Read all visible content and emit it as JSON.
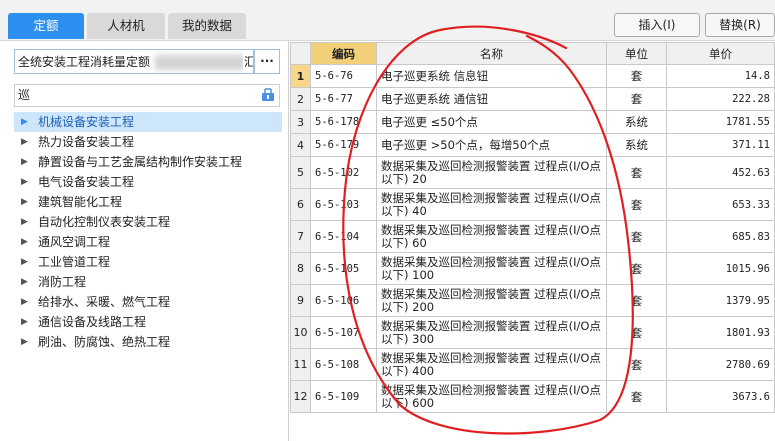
{
  "tabs": [
    {
      "label": "定额",
      "active": true
    },
    {
      "label": "人材机",
      "active": false
    },
    {
      "label": "我的数据",
      "active": false
    }
  ],
  "toolbar": {
    "insert_label": "插入(I)",
    "replace_label": "替换(R)"
  },
  "left_panel": {
    "library_value": "全统安装工程消耗量定额",
    "library_tail": "汇总表",
    "more_label": "···",
    "search_value": "巡",
    "search_icon": "filter-icon",
    "tree": [
      {
        "label": "机械设备安装工程",
        "selected": true
      },
      {
        "label": "热力设备安装工程",
        "selected": false
      },
      {
        "label": "静置设备与工艺金属结构制作安装工程",
        "selected": false
      },
      {
        "label": "电气设备安装工程",
        "selected": false
      },
      {
        "label": "建筑智能化工程",
        "selected": false
      },
      {
        "label": "自动化控制仪表安装工程",
        "selected": false
      },
      {
        "label": "通风空调工程",
        "selected": false
      },
      {
        "label": "工业管道工程",
        "selected": false
      },
      {
        "label": "消防工程",
        "selected": false
      },
      {
        "label": "给排水、采暖、燃气工程",
        "selected": false
      },
      {
        "label": "通信设备及线路工程",
        "selected": false
      },
      {
        "label": "刷油、防腐蚀、绝热工程",
        "selected": false
      }
    ]
  },
  "grid": {
    "columns": [
      "编码",
      "名称",
      "单位",
      "单价"
    ],
    "rows": [
      {
        "no": "1",
        "code": "5-6-76",
        "name": "电子巡更系统 信息钮",
        "unit": "套",
        "price": "14.8"
      },
      {
        "no": "2",
        "code": "5-6-77",
        "name": "电子巡更系统 通信钮",
        "unit": "套",
        "price": "222.28"
      },
      {
        "no": "3",
        "code": "5-6-178",
        "name": "电子巡更 ≤50个点",
        "unit": "系统",
        "price": "1781.55"
      },
      {
        "no": "4",
        "code": "5-6-179",
        "name": "电子巡更 >50个点，每增50个点",
        "unit": "系统",
        "price": "371.11"
      },
      {
        "no": "5",
        "code": "6-5-102",
        "name": "数据采集及巡回检测报警装置 过程点(I/O点以下) 20",
        "unit": "套",
        "price": "452.63"
      },
      {
        "no": "6",
        "code": "6-5-103",
        "name": "数据采集及巡回检测报警装置 过程点(I/O点以下) 40",
        "unit": "套",
        "price": "653.33"
      },
      {
        "no": "7",
        "code": "6-5-104",
        "name": "数据采集及巡回检测报警装置 过程点(I/O点以下) 60",
        "unit": "套",
        "price": "685.83"
      },
      {
        "no": "8",
        "code": "6-5-105",
        "name": "数据采集及巡回检测报警装置 过程点(I/O点以下) 100",
        "unit": "套",
        "price": "1015.96"
      },
      {
        "no": "9",
        "code": "6-5-106",
        "name": "数据采集及巡回检测报警装置 过程点(I/O点以下) 200",
        "unit": "套",
        "price": "1379.95"
      },
      {
        "no": "10",
        "code": "6-5-107",
        "name": "数据采集及巡回检测报警装置 过程点(I/O点以下) 300",
        "unit": "套",
        "price": "1801.93"
      },
      {
        "no": "11",
        "code": "6-5-108",
        "name": "数据采集及巡回检测报警装置 过程点(I/O点以下) 400",
        "unit": "套",
        "price": "2780.69"
      },
      {
        "no": "12",
        "code": "6-5-109",
        "name": "数据采集及巡回检测报警装置 过程点(I/O点以下) 600",
        "unit": "套",
        "price": "3673.6"
      }
    ]
  },
  "colors": {
    "accent": "#2d8ff0",
    "sorted_header": "#f2cf79",
    "annotation": "#e02020"
  }
}
